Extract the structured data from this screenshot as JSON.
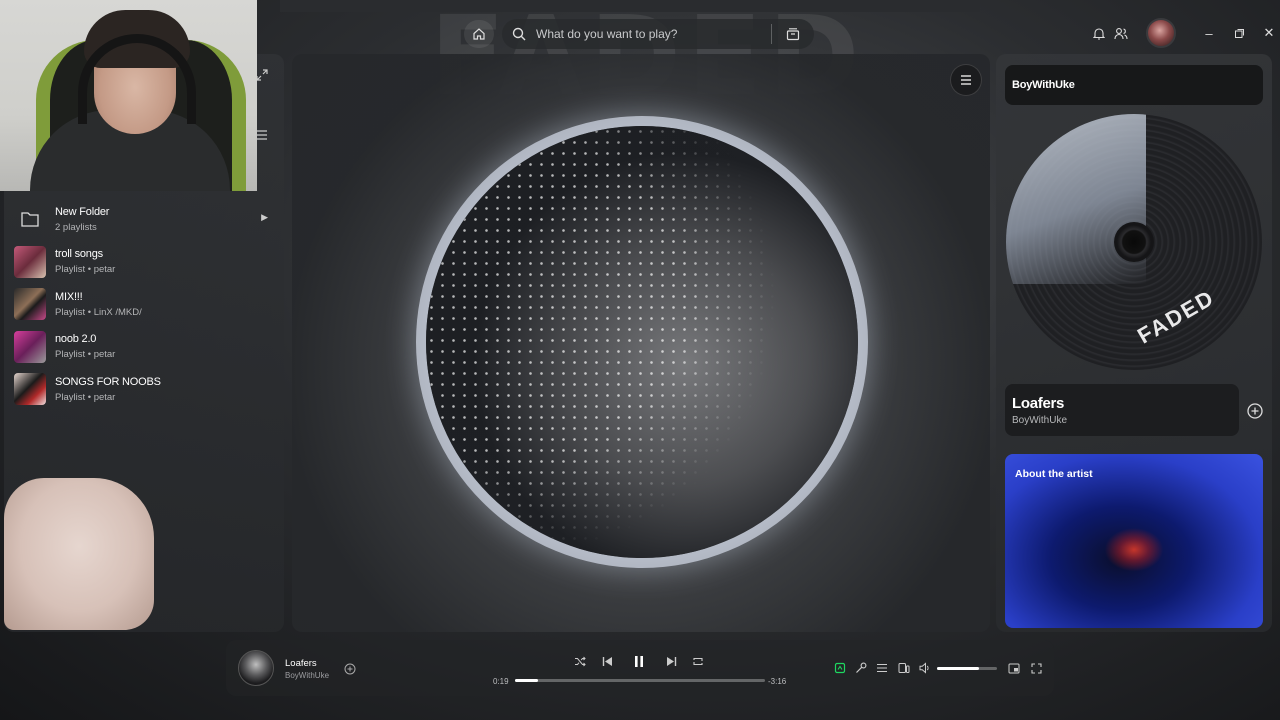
{
  "search": {
    "placeholder": "What do you want to play?"
  },
  "library": {
    "items": [
      {
        "title": "New Folder",
        "subtitle": "2 playlists",
        "type": "folder"
      },
      {
        "title": "troll songs",
        "subtitle": "Playlist • petar"
      },
      {
        "title": "MIX!!!",
        "subtitle": "Playlist • LinX /MKD/"
      },
      {
        "title": "noob 2.0",
        "subtitle": "Playlist • petar"
      },
      {
        "title": "SONGS FOR NOOBS",
        "subtitle": "Playlist • petar"
      }
    ]
  },
  "right_panel": {
    "artist_header": "BoyWithUke",
    "album_text": "FADED",
    "track_title": "Loafers",
    "track_artist": "BoyWithUke",
    "about_title": "About the artist"
  },
  "player": {
    "title": "Loafers",
    "artist": "BoyWithUke",
    "elapsed": "0:19",
    "remaining": "-3:16",
    "progress": 0.09,
    "volume": 0.7
  },
  "colors": {
    "accent": "#1ed760"
  },
  "icons": [
    "home-icon",
    "search-icon",
    "browse-icon",
    "bell-icon",
    "friends-icon",
    "minimize-icon",
    "maximize-icon",
    "close-icon",
    "menu-icon",
    "shuffle-icon",
    "previous-icon",
    "pause-icon",
    "next-icon",
    "repeat-icon",
    "now-playing-view-icon",
    "lyrics-icon",
    "queue-icon",
    "connect-device-icon",
    "volume-icon",
    "miniplayer-icon",
    "fullscreen-icon",
    "folder-icon",
    "plus-circle-icon",
    "expand-icon",
    "list-icon"
  ]
}
